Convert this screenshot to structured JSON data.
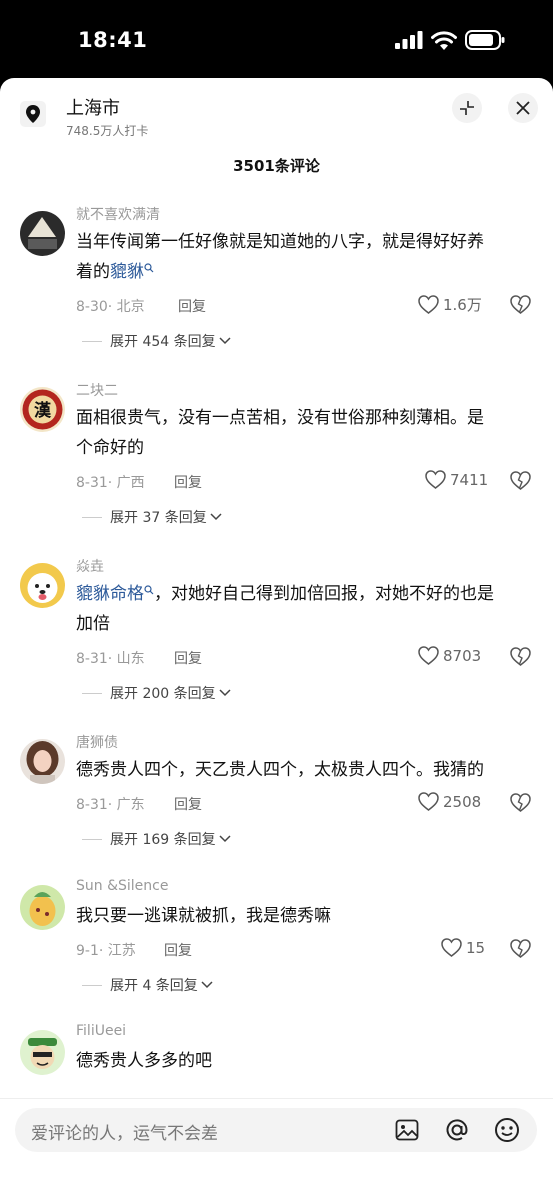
{
  "status": {
    "time": "18:41"
  },
  "header": {
    "location": "上海市",
    "checkins": "748.5万人打卡"
  },
  "comment_count": "3501条评论",
  "comments": [
    {
      "name": "就不喜欢满清",
      "text_lines": [
        "当年传闻第一任好像就是知道她的八字，就是得好好养",
        "着的"
      ],
      "link": "貔貅",
      "date": "8-30· 北京",
      "reply": "回复",
      "likes": "1.6万",
      "expand": "展开 454 条回复"
    },
    {
      "name": "二块二",
      "text_lines": [
        "面相很贵气，没有一点苦相，没有世俗那种刻薄相。是",
        "个命好的"
      ],
      "date": "8-31· 广西",
      "reply": "回复",
      "likes": "7411",
      "expand": "展开 37 条回复"
    },
    {
      "name": "焱垚",
      "link": "貔貅命格",
      "text_lines": [
        "，对她好自己得到加倍回报，对她不好的也是",
        "加倍"
      ],
      "date": "8-31· 山东",
      "reply": "回复",
      "likes": "8703",
      "expand": "展开 200 条回复"
    },
    {
      "name": "唐狮债",
      "text_lines": [
        "德秀贵人四个，天乙贵人四个，太极贵人四个。我猜的"
      ],
      "date": "8-31· 广东",
      "reply": "回复",
      "likes": "2508",
      "expand": "展开 169 条回复"
    },
    {
      "name": "Sun &Silence",
      "text_lines": [
        "我只要一逃课就被抓，我是德秀嘛"
      ],
      "date": "9-1· 江苏",
      "reply": "回复",
      "likes": "15",
      "expand": "展开 4 条回复"
    },
    {
      "name": "FiliUeei",
      "text_lines": [
        "德秀贵人多多的吧"
      ]
    }
  ],
  "input": {
    "placeholder": "爱评论的人，运气不会差"
  },
  "icons": {
    "status": [
      "signal-icon",
      "wifi-icon",
      "battery-icon"
    ],
    "header": [
      "location-pin-icon",
      "collapse-icon",
      "close-icon"
    ],
    "comment": [
      "heart-icon",
      "broken-heart-icon",
      "chevron-down-icon",
      "search-tag-icon"
    ],
    "bottom": [
      "image-icon",
      "at-icon",
      "emoji-icon"
    ]
  },
  "colors": {
    "link": "#2d5a9a",
    "meta": "#999999"
  }
}
